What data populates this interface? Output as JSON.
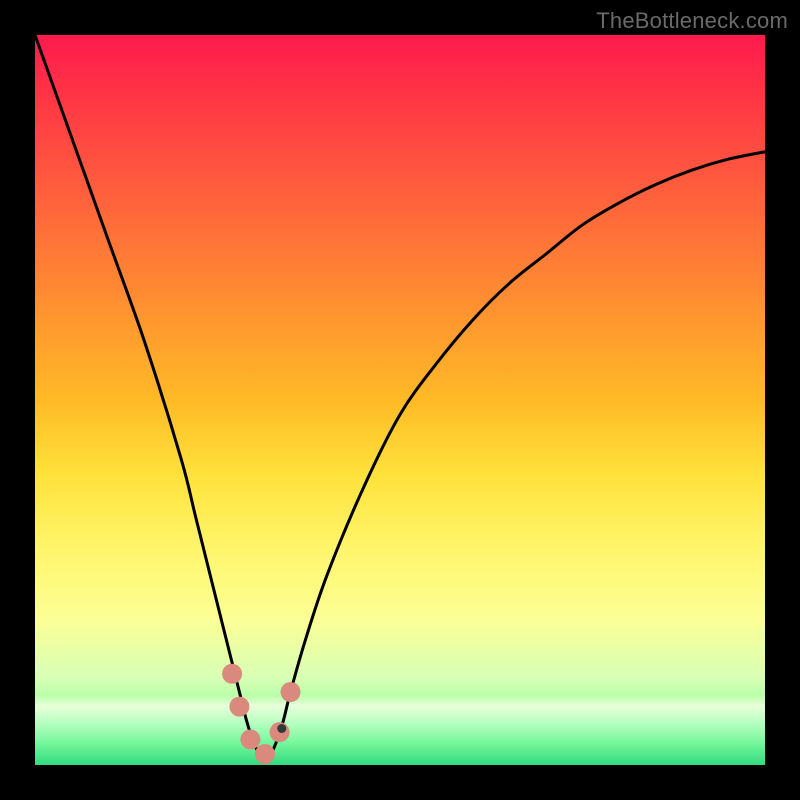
{
  "watermark": "TheBottleneck.com",
  "chart_data": {
    "type": "line",
    "title": "",
    "xlabel": "",
    "ylabel": "",
    "xlim": [
      0,
      100
    ],
    "ylim": [
      0,
      100
    ],
    "series": [
      {
        "name": "bottleneck-curve",
        "x": [
          0,
          5,
          10,
          15,
          20,
          22,
          24,
          26,
          27,
          28,
          29,
          30,
          31,
          32,
          33,
          34,
          35,
          37,
          40,
          45,
          50,
          55,
          60,
          65,
          70,
          75,
          80,
          85,
          90,
          95,
          100
        ],
        "values": [
          100,
          86,
          72,
          58,
          42,
          34,
          26,
          18,
          14,
          10,
          6,
          3,
          1,
          1,
          3,
          6,
          10,
          17,
          26,
          38,
          48,
          55,
          61,
          66,
          70,
          74,
          77,
          79.5,
          81.5,
          83,
          84
        ]
      }
    ],
    "markers": [
      {
        "name": "marker-left-upper",
        "x": 27.0,
        "y": 12.5
      },
      {
        "name": "marker-left-mid",
        "x": 28.0,
        "y": 8.0
      },
      {
        "name": "marker-left-lower",
        "x": 29.5,
        "y": 3.5
      },
      {
        "name": "marker-bottom",
        "x": 31.5,
        "y": 1.5
      },
      {
        "name": "marker-right-lower",
        "x": 33.5,
        "y": 4.5
      },
      {
        "name": "marker-right-upper",
        "x": 35.0,
        "y": 10.0
      },
      {
        "name": "marker-dot",
        "x": 33.8,
        "y": 5.0
      }
    ],
    "colors": {
      "curve": "#000000",
      "marker": "#d98a7c",
      "marker_dot": "#2a3b3a"
    }
  }
}
